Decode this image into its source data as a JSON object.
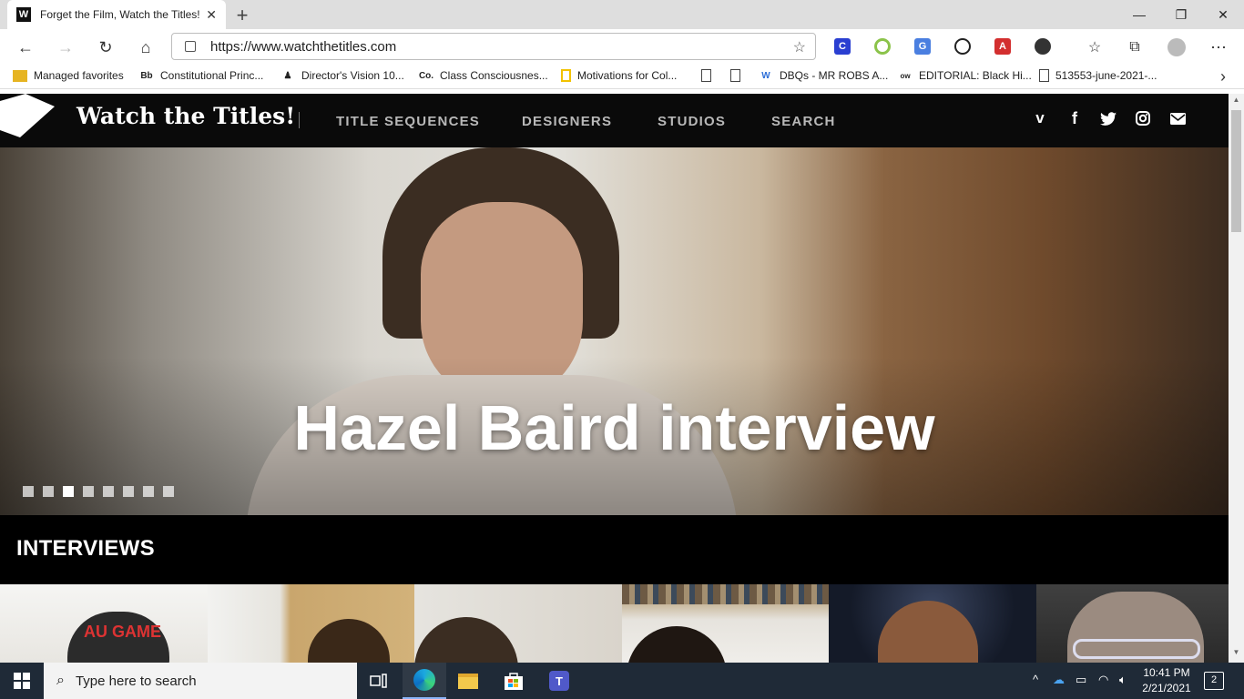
{
  "browser": {
    "tab": {
      "title": "Forget the Film, Watch the Titles!",
      "favicon": "W"
    },
    "url": "https://www.watchthetitles.com",
    "favorites": [
      {
        "label": "Managed favorites",
        "icon": "folder-icon"
      },
      {
        "label": "Constitutional Princ...",
        "icon": "Bb"
      },
      {
        "label": "Director's Vision 10...",
        "icon": "person-icon"
      },
      {
        "label": "Class Consciousnes...",
        "icon": "Co."
      },
      {
        "label": "Motivations for Col...",
        "icon": "note-icon"
      },
      {
        "label": "",
        "icon": "page-icon"
      },
      {
        "label": "",
        "icon": "page-icon"
      },
      {
        "label": "DBQs - MR ROBS A...",
        "icon": "W"
      },
      {
        "label": "EDITORIAL: Black Hi...",
        "icon": "ow"
      },
      {
        "label": "513553-june-2021-...",
        "icon": "page-icon"
      }
    ]
  },
  "site": {
    "title": "Watch the Titles!",
    "nav": [
      "TITLE SEQUENCES",
      "DESIGNERS",
      "STUDIOS",
      "SEARCH"
    ],
    "social": [
      "vimeo-icon",
      "facebook-icon",
      "twitter-icon",
      "instagram-icon",
      "email-icon"
    ],
    "hero": {
      "title": "Hazel Baird interview",
      "slide_count": 8,
      "active_slide": 3
    },
    "section": "INTERVIEWS"
  },
  "taskbar": {
    "search_placeholder": "Type here to search",
    "time": "10:41 PM",
    "date": "2/21/2021",
    "notifications": "2"
  }
}
